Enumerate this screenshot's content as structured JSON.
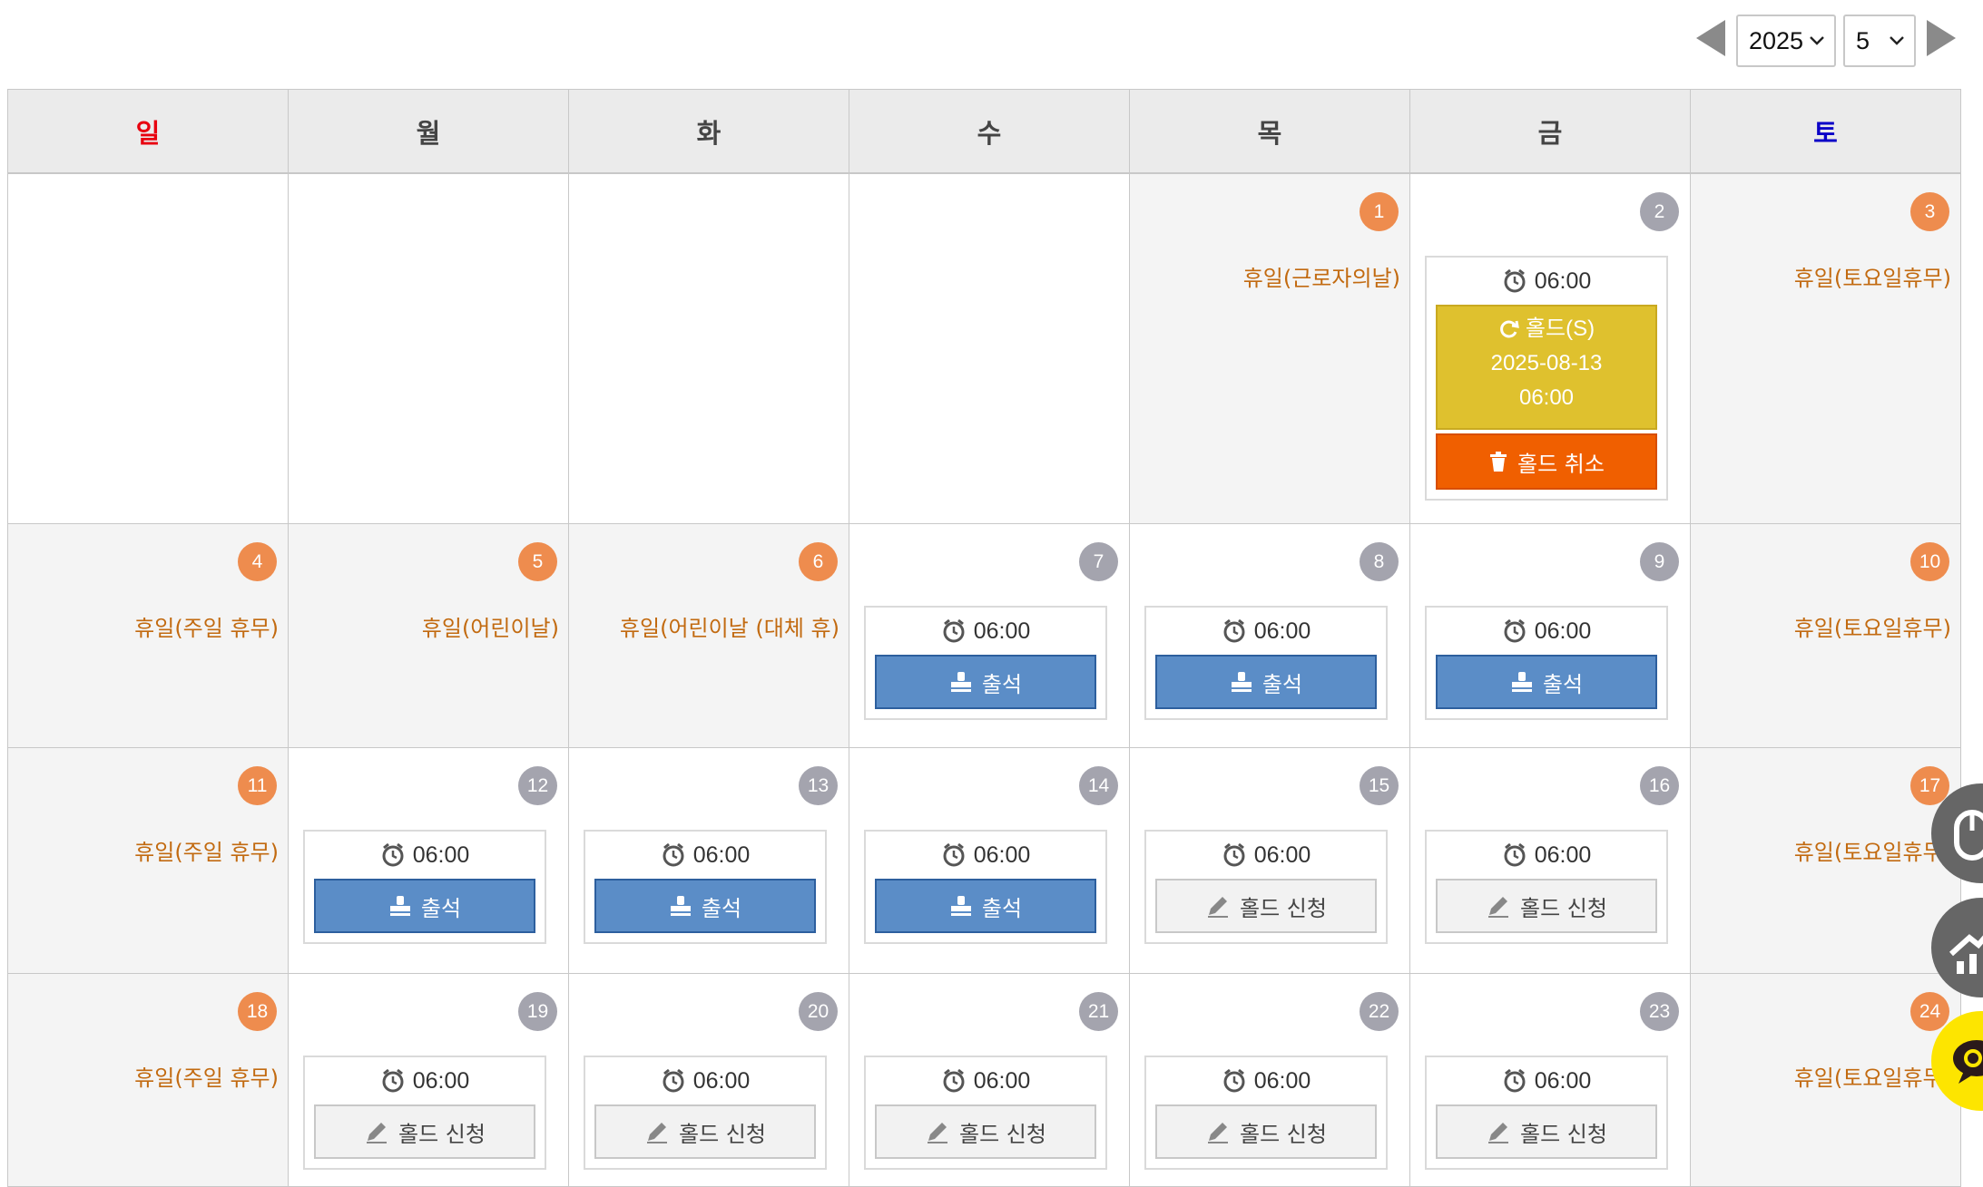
{
  "nav": {
    "year": "2025",
    "month": "5"
  },
  "weekdays": [
    "일",
    "월",
    "화",
    "수",
    "목",
    "금",
    "토"
  ],
  "weeks": [
    [
      {
        "day": "",
        "empty": true
      },
      {
        "day": "",
        "empty": true
      },
      {
        "day": "",
        "empty": true
      },
      {
        "day": "",
        "empty": true
      },
      {
        "day": "1",
        "holiday": "휴일(근로자의날)"
      },
      {
        "day": "2",
        "time": "06:00",
        "hold": {
          "label": "홀드(S)",
          "date": "2025-08-13",
          "time": "06:00",
          "cancel": "홀드 취소"
        }
      },
      {
        "day": "3",
        "holiday": "휴일(토요일휴무)"
      }
    ],
    [
      {
        "day": "4",
        "holiday": "휴일(주일 휴무)"
      },
      {
        "day": "5",
        "holiday": "휴일(어린이날)"
      },
      {
        "day": "6",
        "holiday": "휴일(어린이날 (대체 휴)"
      },
      {
        "day": "7",
        "time": "06:00",
        "button": "출석",
        "kind": "attend"
      },
      {
        "day": "8",
        "time": "06:00",
        "button": "출석",
        "kind": "attend"
      },
      {
        "day": "9",
        "time": "06:00",
        "button": "출석",
        "kind": "attend"
      },
      {
        "day": "10",
        "holiday": "휴일(토요일휴무)"
      }
    ],
    [
      {
        "day": "11",
        "holiday": "휴일(주일 휴무)"
      },
      {
        "day": "12",
        "time": "06:00",
        "button": "출석",
        "kind": "attend"
      },
      {
        "day": "13",
        "time": "06:00",
        "button": "출석",
        "kind": "attend"
      },
      {
        "day": "14",
        "time": "06:00",
        "button": "출석",
        "kind": "attend"
      },
      {
        "day": "15",
        "time": "06:00",
        "button": "홀드 신청",
        "kind": "hold"
      },
      {
        "day": "16",
        "time": "06:00",
        "button": "홀드 신청",
        "kind": "hold"
      },
      {
        "day": "17",
        "holiday": "휴일(토요일휴무)"
      }
    ],
    [
      {
        "day": "18",
        "holiday": "휴일(주일 휴무)"
      },
      {
        "day": "19",
        "time": "06:00",
        "button": "홀드 신청",
        "kind": "hold"
      },
      {
        "day": "20",
        "time": "06:00",
        "button": "홀드 신청",
        "kind": "hold"
      },
      {
        "day": "21",
        "time": "06:00",
        "button": "홀드 신청",
        "kind": "hold"
      },
      {
        "day": "22",
        "time": "06:00",
        "button": "홀드 신청",
        "kind": "hold"
      },
      {
        "day": "23",
        "time": "06:00",
        "button": "홀드 신청",
        "kind": "hold"
      },
      {
        "day": "24",
        "holiday": "휴일(토요일휴무)"
      }
    ]
  ],
  "icons": {
    "prev": "prev-month-arrow-icon",
    "next": "next-month-arrow-icon",
    "time": "alarm-clock-icon",
    "attend": "stamp-icon",
    "hold": "pencil-icon",
    "holdinfo": "refresh-icon",
    "cancel": "trash-icon"
  },
  "colors": {
    "holiday_badge": "#ee8c4e",
    "day_badge": "#a4a4ae",
    "holiday_text": "#c26a10",
    "attend_button": "#5b8dc7",
    "hold_info": "#dfc12e",
    "cancel_button": "#f05f00",
    "sunday": "#e8000f",
    "saturday": "#0b00c7"
  }
}
